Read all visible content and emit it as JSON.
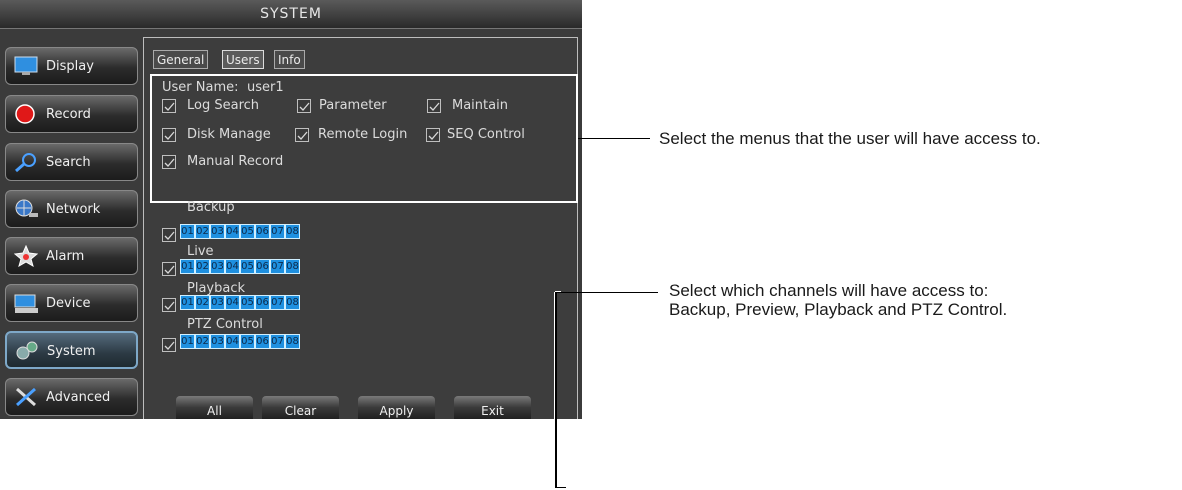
{
  "window": {
    "title": "SYSTEM"
  },
  "sidebar": {
    "items": [
      {
        "label": "Display",
        "icon": "monitor-icon"
      },
      {
        "label": "Record",
        "icon": "record-icon"
      },
      {
        "label": "Search",
        "icon": "search-icon"
      },
      {
        "label": "Network",
        "icon": "network-globe-icon"
      },
      {
        "label": "Alarm",
        "icon": "alarm-icon"
      },
      {
        "label": "Device",
        "icon": "device-icon"
      },
      {
        "label": "System",
        "icon": "system-gears-icon",
        "active": true
      },
      {
        "label": "Advanced",
        "icon": "advanced-tools-icon"
      }
    ]
  },
  "tabs": [
    {
      "label": "General"
    },
    {
      "label": "Users",
      "active": true
    },
    {
      "label": "Info"
    }
  ],
  "user": {
    "label": "User Name:",
    "value": "user1"
  },
  "permissions": [
    {
      "label": "Log Search",
      "checked": true
    },
    {
      "label": "Parameter",
      "checked": true
    },
    {
      "label": "Maintain",
      "checked": true
    },
    {
      "label": "Disk Manage",
      "checked": true
    },
    {
      "label": "Remote Login",
      "checked": true
    },
    {
      "label": "SEQ Control",
      "checked": true
    },
    {
      "label": "Manual Record",
      "checked": true
    }
  ],
  "channel_groups": [
    {
      "label": "Backup",
      "checked": true,
      "channels": [
        "01",
        "02",
        "03",
        "04",
        "05",
        "06",
        "07",
        "08"
      ]
    },
    {
      "label": "Live",
      "checked": true,
      "channels": [
        "01",
        "02",
        "03",
        "04",
        "05",
        "06",
        "07",
        "08"
      ]
    },
    {
      "label": "Playback",
      "checked": true,
      "channels": [
        "01",
        "02",
        "03",
        "04",
        "05",
        "06",
        "07",
        "08"
      ]
    },
    {
      "label": "PTZ Control",
      "checked": true,
      "channels": [
        "01",
        "02",
        "03",
        "04",
        "05",
        "06",
        "07",
        "08"
      ]
    }
  ],
  "footer_buttons": [
    "All",
    "Clear",
    "Apply",
    "Exit"
  ],
  "annotations": {
    "menus": "Select the menus that the user will have access to.",
    "channels_line1": "Select which channels will have access to:",
    "channels_line2": "Backup, Preview, Playback and PTZ Control."
  },
  "colors": {
    "channel_fill": "#1e90e0",
    "ui_background": "#3b3b3b",
    "annotation_line": "#000000"
  }
}
